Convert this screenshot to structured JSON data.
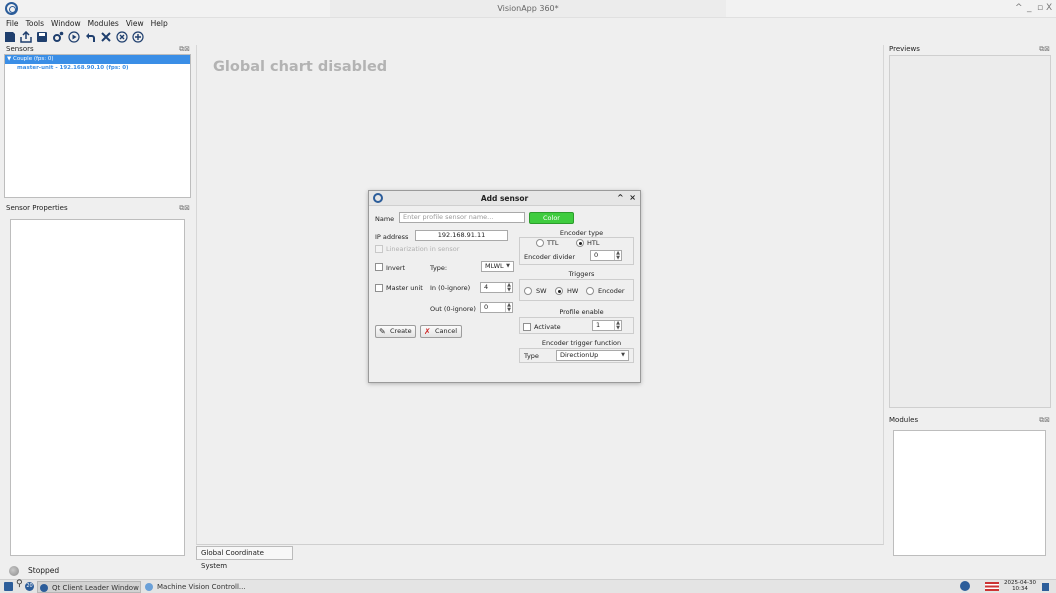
{
  "window": {
    "title": "VisionApp 360*",
    "controls": [
      "^",
      "_",
      "▫",
      "X"
    ]
  },
  "menu": [
    "File",
    "Tools",
    "Window",
    "Modules",
    "View",
    "Help"
  ],
  "toolbar": {
    "icons": [
      "save-icon",
      "export-icon",
      "save-as-icon",
      "settings-icon",
      "play-icon",
      "undo-icon",
      "tools-icon",
      "stop-icon",
      "add-icon"
    ]
  },
  "sensors_panel": {
    "title": "Sensors",
    "tree": {
      "root": "Couple (fps: 0)",
      "child": "master-unit - 192.168.90.10 (fps: 0)"
    }
  },
  "sensor_properties_panel": {
    "title": "Sensor Properties"
  },
  "center": {
    "message": "Global chart disabled",
    "tab_label": "Global Coordinate System"
  },
  "previews_panel": {
    "title": "Previews"
  },
  "modules_panel": {
    "title": "Modules"
  },
  "status": {
    "text": "Stopped"
  },
  "taskbar": {
    "tasks": [
      "Qt Client Leader Window",
      "Machine Vision Controll..."
    ],
    "badge": "20",
    "date": "2025-04-30",
    "time": "10:34"
  },
  "dialog": {
    "title": "Add sensor",
    "name_label": "Name",
    "name_placeholder": "Enter profile sensor name...",
    "color_button": "Color",
    "ip_label": "IP address",
    "ip_value": "192.168.91.11",
    "linearization_label": "Linearization in sensor",
    "invert_label": "Invert",
    "type_label": "Type:",
    "type_value": "MLWL",
    "master_unit_label": "Master unit",
    "in_label": "In (0-ignore)",
    "in_value": "4",
    "out_label": "Out (0-ignore)",
    "out_value": "0",
    "create_button": "Create",
    "cancel_button": "Cancel",
    "encoder_type_title": "Encoder type",
    "ttl_label": "TTL",
    "htl_label": "HTL",
    "encoder_divider_label": "Encoder divider",
    "encoder_divider_value": "0",
    "triggers_title": "Triggers",
    "sw_label": "SW",
    "hw_label": "HW",
    "encoder_label": "Encoder",
    "profile_enable_title": "Profile enable",
    "activate_label": "Activate",
    "activate_value": "1",
    "encoder_trigger_title": "Encoder trigger function",
    "trigger_type_label": "Type",
    "trigger_type_value": "DirectionUp"
  },
  "colors": {
    "accent": "#3a8ee6",
    "color_button": "#3fcc3f",
    "brand": "#2c5d9a"
  }
}
